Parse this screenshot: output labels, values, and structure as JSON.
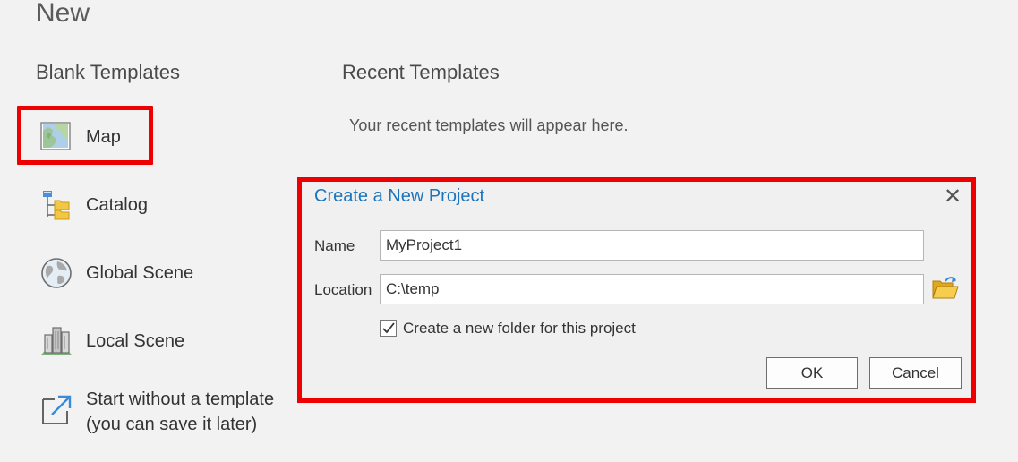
{
  "page": {
    "title": "New",
    "blank_templates_heading": "Blank Templates",
    "recent_templates_heading": "Recent Templates",
    "recent_empty_text": "Your recent templates will appear here."
  },
  "blank_templates": {
    "map": "Map",
    "catalog": "Catalog",
    "global_scene": "Global Scene",
    "local_scene": "Local Scene",
    "start_line1": "Start without a template",
    "start_line2": "(you can save it later)"
  },
  "dialog": {
    "title": "Create a New Project",
    "close_glyph": "✕",
    "name_label": "Name",
    "name_value": "MyProject1",
    "location_label": "Location",
    "location_value": "C:\\temp",
    "new_folder_label": "Create a new folder for this project",
    "new_folder_checked": true,
    "ok_label": "OK",
    "cancel_label": "Cancel"
  },
  "colors": {
    "highlight": "#ee0000",
    "dialog_title": "#1c75bc",
    "background": "#f2f2f2"
  },
  "icons": {
    "map": "map-icon",
    "catalog": "catalog-icon",
    "global_scene": "globe-icon",
    "local_scene": "buildings-icon",
    "start": "open-arrow-icon",
    "browse": "folder-open-icon",
    "close": "close-icon",
    "check": "checkmark-icon"
  }
}
